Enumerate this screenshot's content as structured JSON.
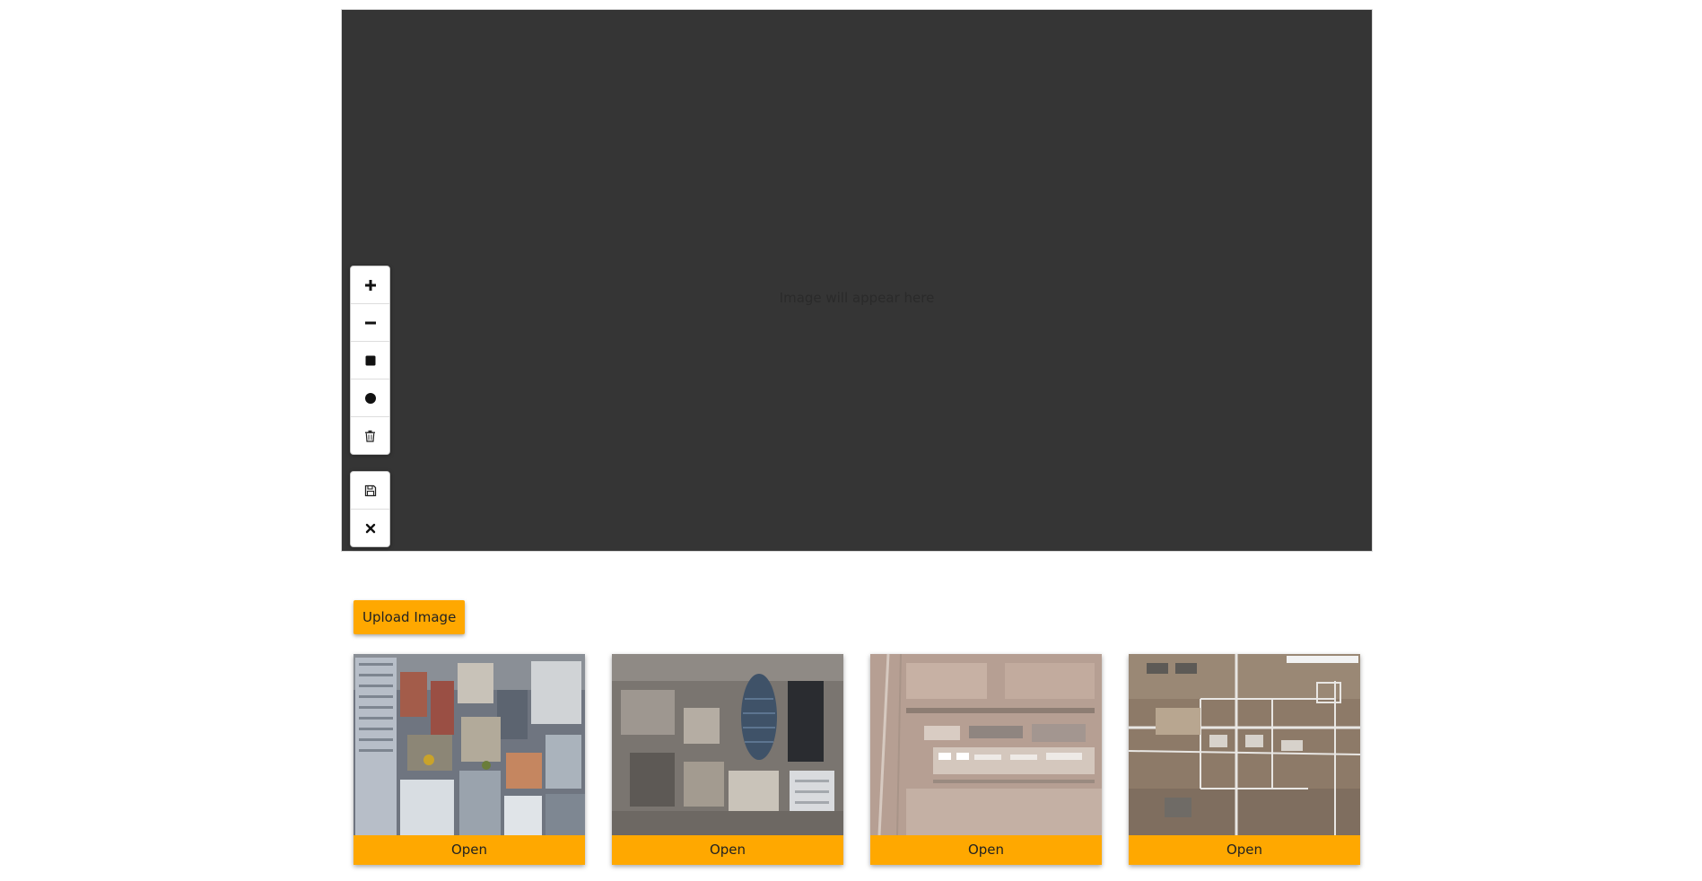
{
  "viewer": {
    "placeholder": "Image will appear here",
    "background": "#353535"
  },
  "toolbar": {
    "draw_tools": [
      {
        "icon": "plus-icon",
        "action": "zoom-in"
      },
      {
        "icon": "minus-icon",
        "action": "zoom-out"
      },
      {
        "icon": "square-icon",
        "action": "draw-rectangle"
      },
      {
        "icon": "circle-icon",
        "action": "draw-circle"
      },
      {
        "icon": "trash-icon",
        "action": "delete"
      }
    ],
    "file_tools": [
      {
        "icon": "save-icon",
        "action": "save"
      },
      {
        "icon": "close-icon",
        "action": "close"
      }
    ]
  },
  "upload": {
    "label": "Upload Image"
  },
  "gallery": {
    "accent": "#ffa800",
    "items": [
      {
        "thumbnail": "aerial-city-buildings",
        "button": "Open"
      },
      {
        "thumbnail": "aerial-city-gherkin",
        "button": "Open"
      },
      {
        "thumbnail": "satellite-desert-base",
        "button": "Open"
      },
      {
        "thumbnail": "satellite-map-roads",
        "button": "Open"
      }
    ]
  }
}
